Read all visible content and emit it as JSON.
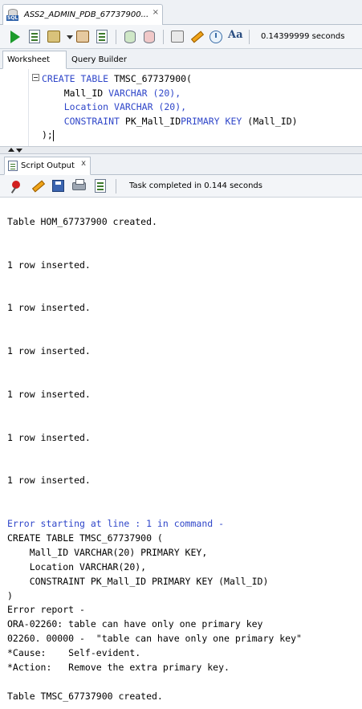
{
  "document_tab": {
    "title": "ASS2_ADMIN_PDB_67737900...",
    "close": "×"
  },
  "toolbar": {
    "elapsed": "0.14399999 seconds"
  },
  "worksheet_tabs": {
    "worksheet": "Worksheet",
    "query_builder": "Query Builder"
  },
  "editor": {
    "lines": [
      {
        "kw1": "CREATE",
        "kw2": "TABLE",
        "id": "TMSC_67737900("
      },
      {
        "id": "Mall_ID",
        "type": "VARCHAR",
        "num": "(20),",
        "indent": "    "
      },
      {
        "id": "Location",
        "type": "VARCHAR",
        "num": "(20),",
        "indent": "    "
      },
      {
        "kw1": "CONSTRAINT",
        "id": "PK_Mall_ID",
        "kw2": "PRIMARY",
        "kw3": "KEY",
        "tail": "(Mall_ID",
        "close": ")"
      },
      {
        "text": ");"
      }
    ]
  },
  "output_tab": {
    "label": "Script Output",
    "close": "x"
  },
  "output_toolbar": {
    "status": "Task completed in 0.144 seconds"
  },
  "output": {
    "lines": [
      "Table HOM_67737900 created.",
      "",
      "",
      "1 row inserted.",
      "",
      "",
      "1 row inserted.",
      "",
      "",
      "1 row inserted.",
      "",
      "",
      "1 row inserted.",
      "",
      "",
      "1 row inserted.",
      "",
      "",
      "1 row inserted.",
      "",
      ""
    ],
    "error_heading": "Error starting at line : 1 in command -",
    "error_lines": [
      "CREATE TABLE TMSC_67737900 (",
      "    Mall_ID VARCHAR(20) PRIMARY KEY,",
      "    Location VARCHAR(20),",
      "    CONSTRAINT PK_Mall_ID PRIMARY KEY (Mall_ID)",
      ")",
      "Error report -",
      "ORA-02260: table can have only one primary key",
      "02260. 00000 -  \"table can have only one primary key\"",
      "*Cause:    Self-evident.",
      "*Action:   Remove the extra primary key.",
      "",
      "Table TMSC_67737900 created."
    ]
  }
}
